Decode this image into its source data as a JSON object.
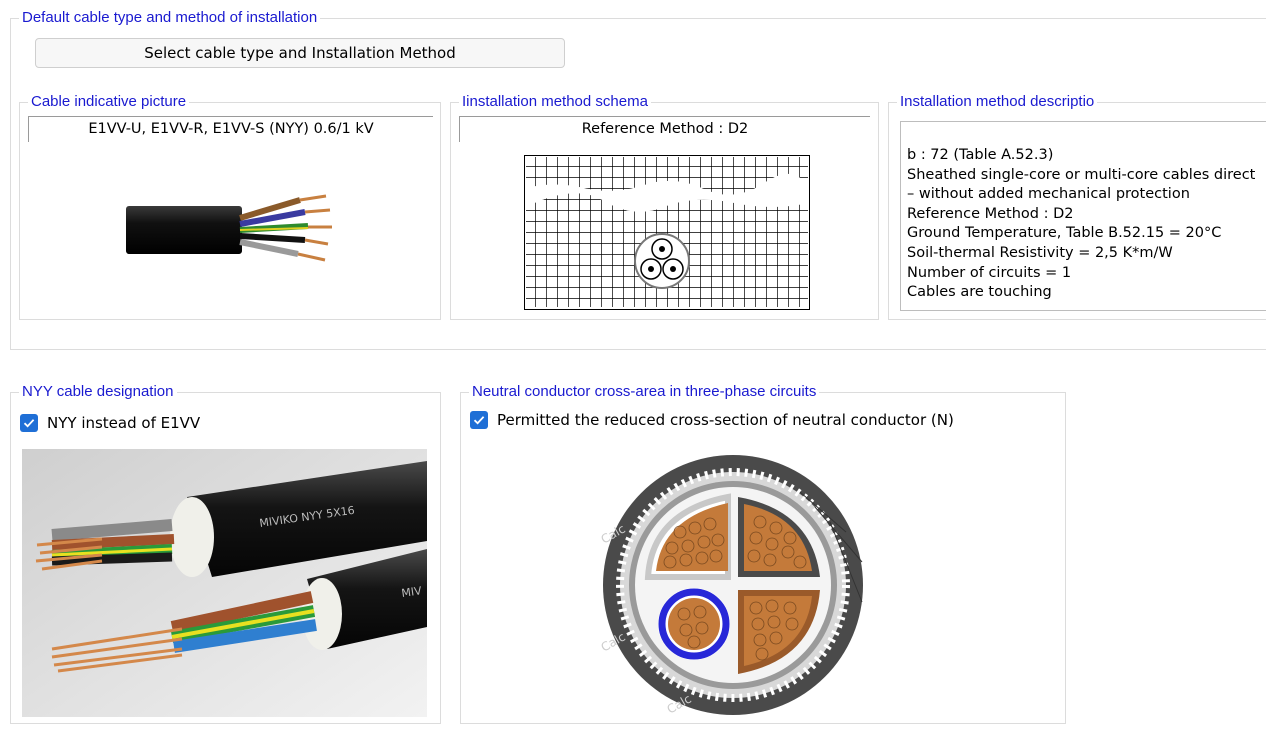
{
  "default_group": {
    "title": "Default cable type and method of installation",
    "select_button_label": "Select cable type and Installation Method"
  },
  "cable_picture": {
    "title": "Cable indicative picture",
    "caption": "E1VV-U, E1VV-R, E1VV-S  (NYY)  0.6/1 kV"
  },
  "schema": {
    "title": "Iinstallation method schema",
    "caption": "Reference Method : D2"
  },
  "description": {
    "title": "Installation method descriptio",
    "lines": [
      "b : 72 (Table A.52.3)",
      "Sheathed single-core or multi-core cables direct",
      "– without added mechanical protection",
      "Reference Method : D2",
      "Ground Temperature, Table B.52.15 = 20°C",
      "Soil-thermal Resistivity = 2,5 K*m/W",
      "Number of circuits = 1",
      "Cables are touching"
    ]
  },
  "nyy_group": {
    "title": "NYY cable designation",
    "checkbox_label": "NYY instead of E1VV",
    "checked": true,
    "photo_print": "MIVIKO NYY 5X16",
    "photo_print_2": "MIV"
  },
  "neutral_group": {
    "title": "Neutral conductor cross-area in three-phase circuits",
    "checkbox_label": "Permitted the reduced cross-section of neutral conductor (N)",
    "checked": true,
    "watermark": "Calc"
  },
  "colors": {
    "accent": "#1a1ad0",
    "checkbox": "#1f6fd6",
    "cable_black": "#111111",
    "copper": "#c47a3a"
  }
}
